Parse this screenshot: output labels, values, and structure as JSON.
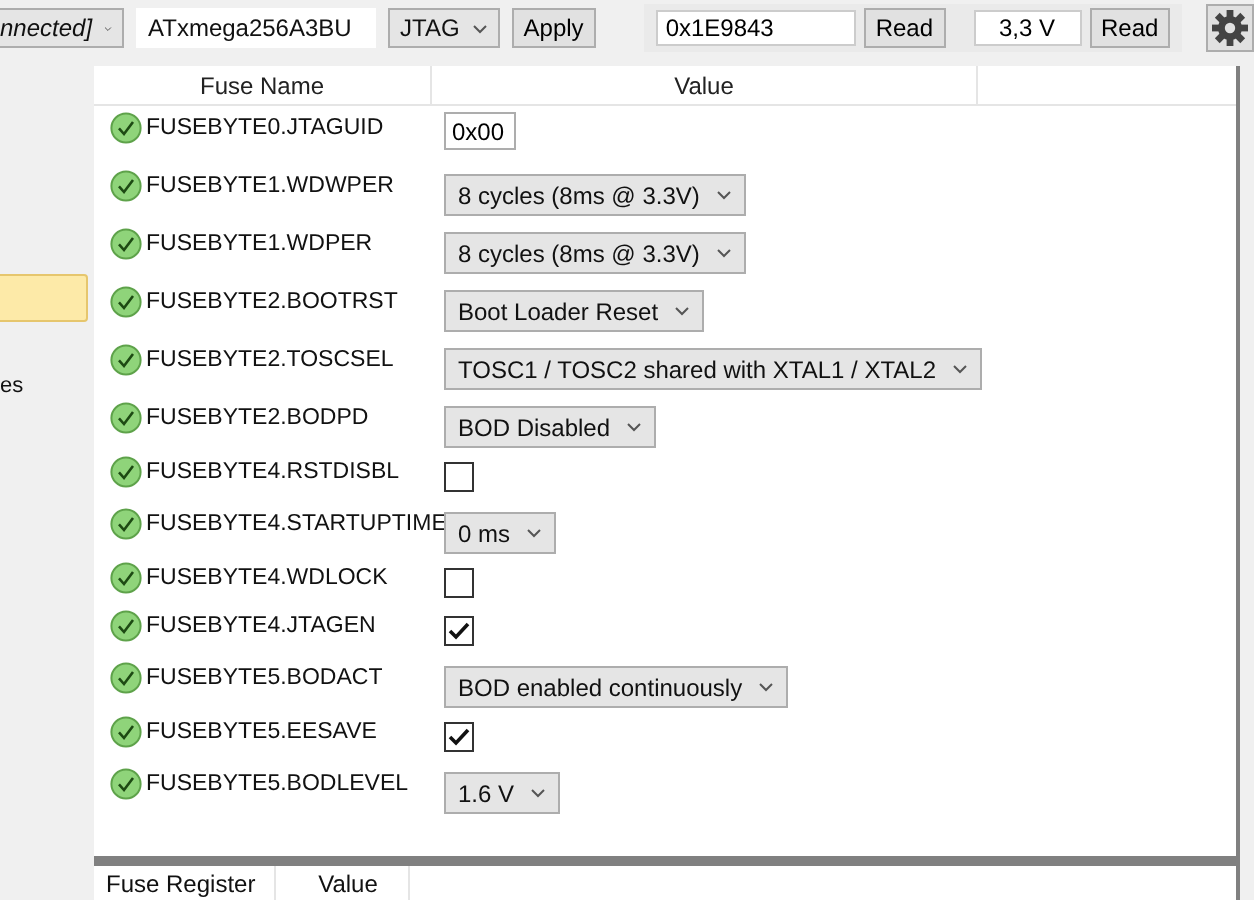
{
  "toolbar": {
    "connection_combo": "nnected]",
    "device_combo": "ATxmega256A3BU",
    "interface_combo": "JTAG",
    "apply_button": "Apply",
    "signature_field": "0x1E9843",
    "signature_read_button": "Read",
    "voltage_field": "3,3 V",
    "voltage_read_button": "Read"
  },
  "sidebar": {
    "items": [
      {
        "selected": true
      },
      {
        "label": "es",
        "selected": false
      }
    ]
  },
  "table": {
    "columns": [
      "Fuse Name",
      "Value"
    ],
    "rows": [
      {
        "name": "FUSEBYTE0.JTAGUID",
        "kind": "text",
        "value": "0x00"
      },
      {
        "name": "FUSEBYTE1.WDWPER",
        "kind": "combo",
        "value": "8 cycles (8ms @ 3.3V)"
      },
      {
        "name": "FUSEBYTE1.WDPER",
        "kind": "combo",
        "value": "8 cycles (8ms @ 3.3V)"
      },
      {
        "name": "FUSEBYTE2.BOOTRST",
        "kind": "combo",
        "value": "Boot Loader Reset"
      },
      {
        "name": "FUSEBYTE2.TOSCSEL",
        "kind": "combo",
        "value": "TOSC1 / TOSC2 shared with XTAL1 / XTAL2"
      },
      {
        "name": "FUSEBYTE2.BODPD",
        "kind": "combo",
        "value": "BOD Disabled"
      },
      {
        "name": "FUSEBYTE4.RSTDISBL",
        "kind": "checkbox",
        "checked": false
      },
      {
        "name": "FUSEBYTE4.STARTUPTIME",
        "kind": "combo",
        "value": "0 ms"
      },
      {
        "name": "FUSEBYTE4.WDLOCK",
        "kind": "checkbox",
        "checked": false
      },
      {
        "name": "FUSEBYTE4.JTAGEN",
        "kind": "checkbox",
        "checked": true
      },
      {
        "name": "FUSEBYTE5.BODACT",
        "kind": "combo",
        "value": "BOD enabled continuously"
      },
      {
        "name": "FUSEBYTE5.EESAVE",
        "kind": "checkbox",
        "checked": true
      },
      {
        "name": "FUSEBYTE5.BODLEVEL",
        "kind": "combo",
        "value": "1.6 V"
      }
    ]
  },
  "register_table": {
    "columns": [
      "Fuse Register",
      "Value"
    ]
  }
}
